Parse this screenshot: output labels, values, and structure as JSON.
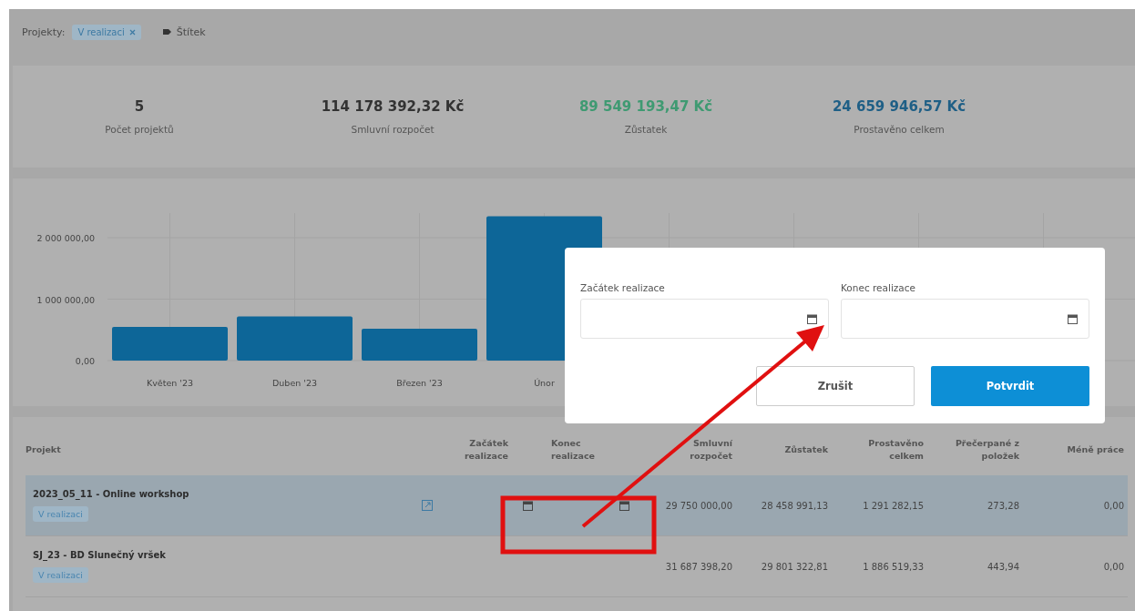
{
  "filter_bar": {
    "label": "Projekty:",
    "chips": [
      {
        "text": "V realizaci"
      }
    ],
    "tag_button": "Štítek"
  },
  "stats": [
    {
      "value": "5",
      "label": "Počet projektů",
      "color": "#333333"
    },
    {
      "value": "114 178 392,32 Kč",
      "label": "Smluvní rozpočet",
      "color": "#333333"
    },
    {
      "value": "89 549 193,47 Kč",
      "label": "Zůstatek",
      "color": "#3f9a72"
    },
    {
      "value": "24 659 946,57 Kč",
      "label": "Prostavěno celkem",
      "color": "#1f5f86"
    }
  ],
  "chart": {
    "chart_data": {
      "type": "bar",
      "grid": true,
      "ylim": [
        0,
        2400000
      ],
      "categories": [
        "Květen '23",
        "Duben '23",
        "Březen '23",
        "Únor"
      ],
      "values": [
        550000,
        720000,
        520000,
        2350000
      ],
      "yticks": [
        {
          "value": 0,
          "label": "0,00"
        },
        {
          "value": 1000000,
          "label": "1 000 000,00"
        },
        {
          "value": 2000000,
          "label": "2 000 000,00"
        }
      ]
    }
  },
  "table": {
    "columns": [
      "Projekt",
      "Začátek realizace",
      "Konec realizace",
      "Smluvní rozpočet",
      "Zůstatek",
      "Prostavěno celkem",
      "Přečerpané z položek",
      "Méně práce"
    ],
    "rows": [
      {
        "project": "2023_05_11 - Online workshop",
        "status": "V realizaci",
        "selected": true,
        "has_link": true,
        "date_pickers": true,
        "values": [
          "29 750 000,00",
          "28 458 991,13",
          "1 291 282,15",
          "273,28",
          "0,00"
        ]
      },
      {
        "project": "SJ_23 - BD Slunečný vršek",
        "status": "V realizaci",
        "selected": false,
        "has_link": false,
        "date_pickers": false,
        "values": [
          "31 687 398,20",
          "29 801 322,81",
          "1 886 519,33",
          "443,94",
          "0,00"
        ]
      }
    ]
  },
  "dialog": {
    "fields": [
      {
        "label": "Začátek realizace"
      },
      {
        "label": "Konec realizace"
      }
    ],
    "buttons": [
      {
        "text": "Zrušit",
        "kind": "secondary"
      },
      {
        "text": "Potvrdit",
        "kind": "primary"
      }
    ]
  }
}
